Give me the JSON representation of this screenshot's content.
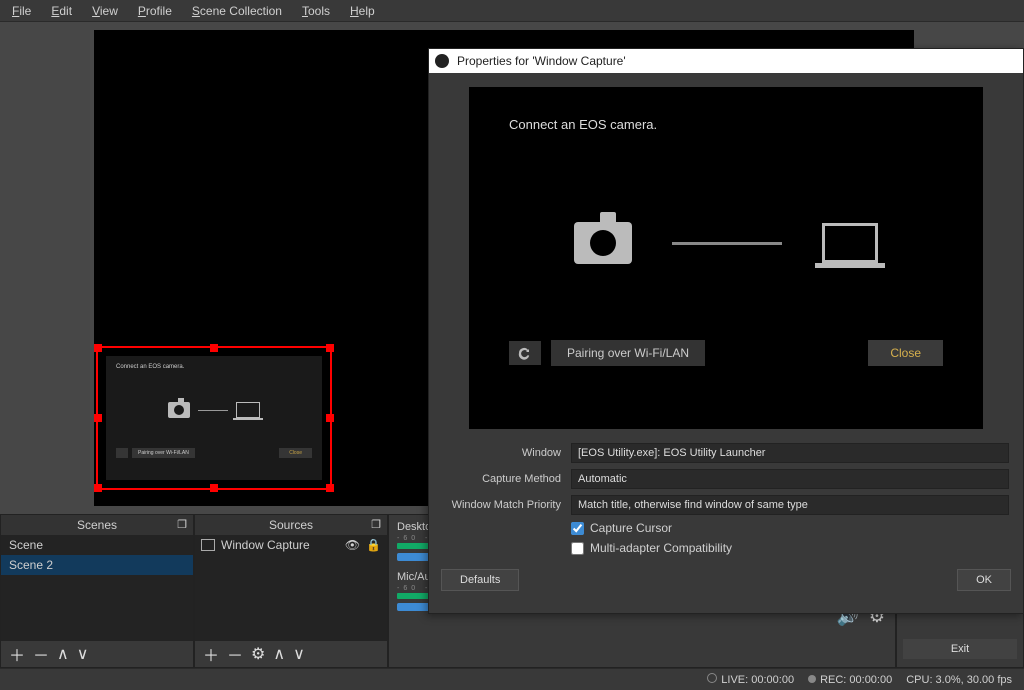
{
  "menu": {
    "file": "File",
    "edit": "Edit",
    "view": "View",
    "profile": "Profile",
    "scene_collection": "Scene Collection",
    "tools": "Tools",
    "help": "Help"
  },
  "capture_mini": {
    "title": "Connect an EOS camera.",
    "pair": "Pairing over Wi-Fi/LAN",
    "close": "Close"
  },
  "scenes": {
    "title": "Scenes",
    "items": [
      {
        "label": "Scene",
        "selected": false
      },
      {
        "label": "Scene 2",
        "selected": true
      }
    ]
  },
  "sources": {
    "title": "Sources",
    "items": [
      {
        "label": "Window Capture"
      }
    ]
  },
  "mixer": {
    "desktop": {
      "label": "Desktop"
    },
    "mic": {
      "label": "Mic/Aux"
    }
  },
  "controls": {
    "exit": "Exit"
  },
  "status": {
    "live": "LIVE: 00:00:00",
    "rec": "REC: 00:00:00",
    "cpu": "CPU: 3.0%, 30.00 fps"
  },
  "dialog": {
    "title": "Properties for 'Window Capture'",
    "eos_text": "Connect an EOS camera.",
    "pair_btn": "Pairing over Wi-Fi/LAN",
    "close_btn": "Close",
    "window_label": "Window",
    "window_value": "[EOS Utility.exe]: EOS Utility Launcher",
    "method_label": "Capture Method",
    "method_value": "Automatic",
    "priority_label": "Window Match Priority",
    "priority_value": "Match title, otherwise find window of same type",
    "cursor_label": "Capture Cursor",
    "multi_label": "Multi-adapter Compatibility",
    "defaults": "Defaults",
    "ok": "OK"
  }
}
